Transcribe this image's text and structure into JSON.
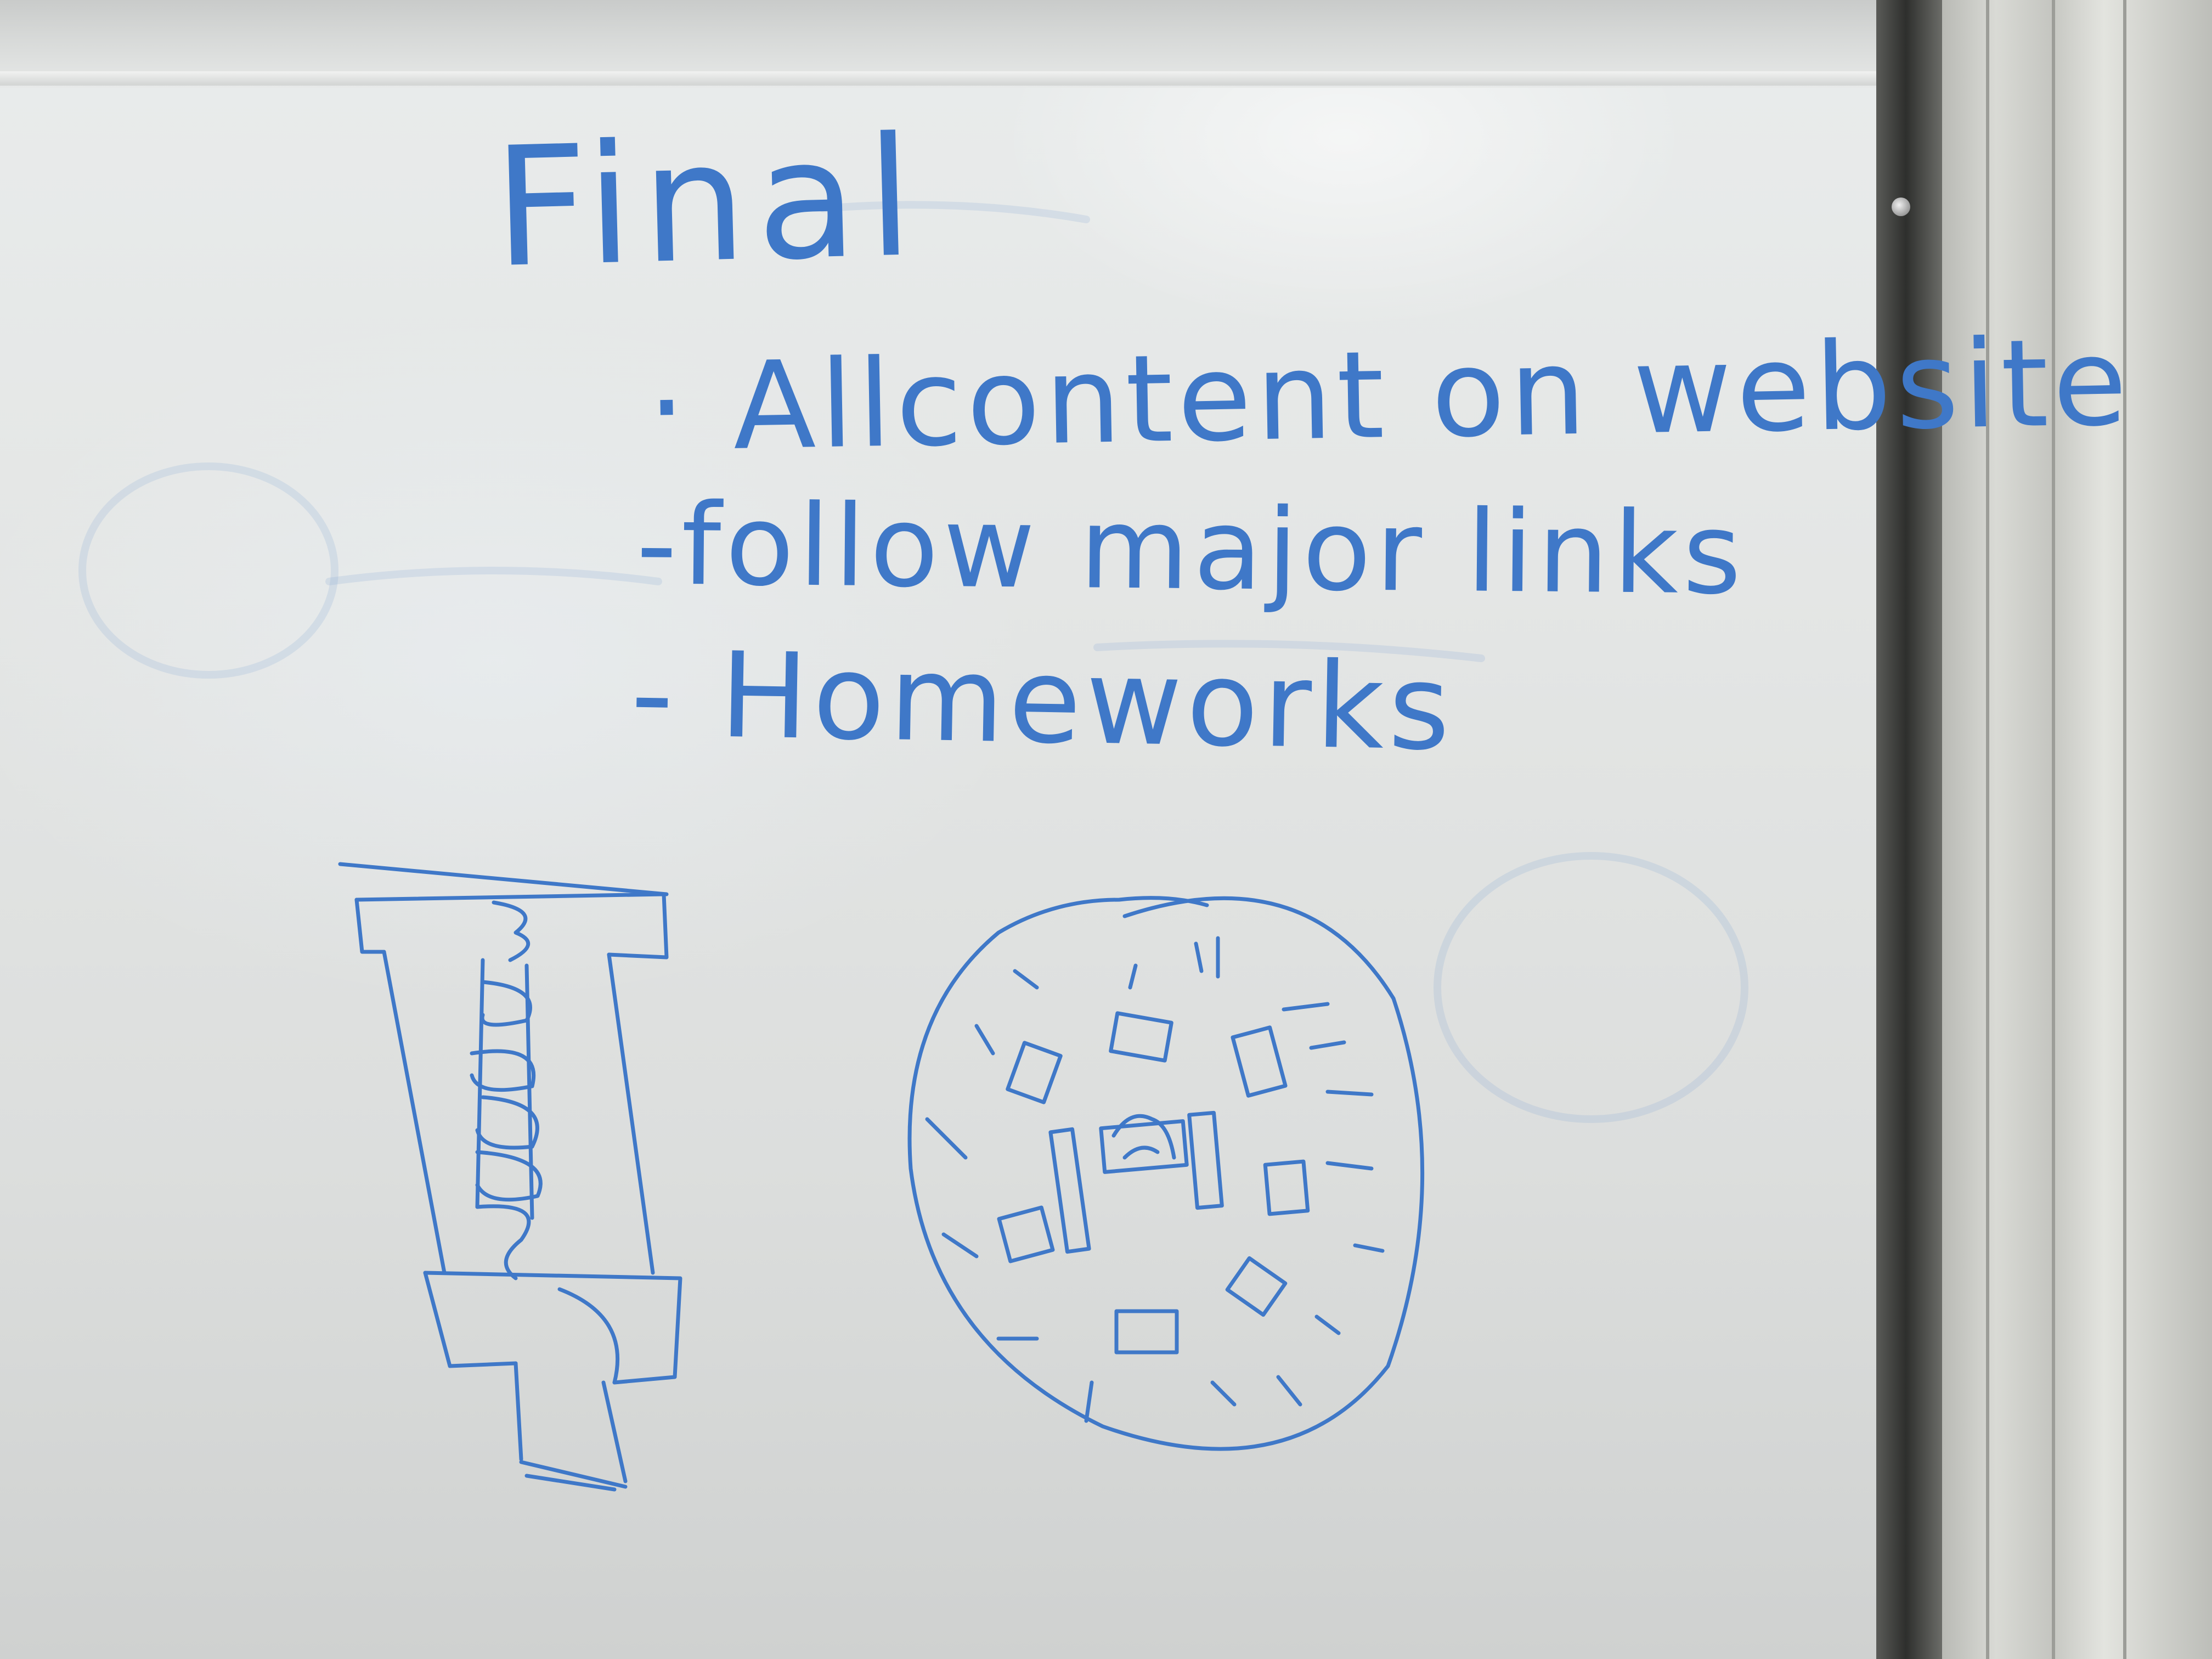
{
  "whiteboard": {
    "title": "Final",
    "items": [
      {
        "text": "· Allcontent on website"
      },
      {
        "text": "-follow major links"
      },
      {
        "text": "- Homeworks"
      }
    ]
  },
  "colors": {
    "marker_ink": "#3f78c8",
    "board_surface": "#e4e6e5",
    "frame_dark": "#2e2f2d",
    "frame_light": "#d9dad5"
  }
}
